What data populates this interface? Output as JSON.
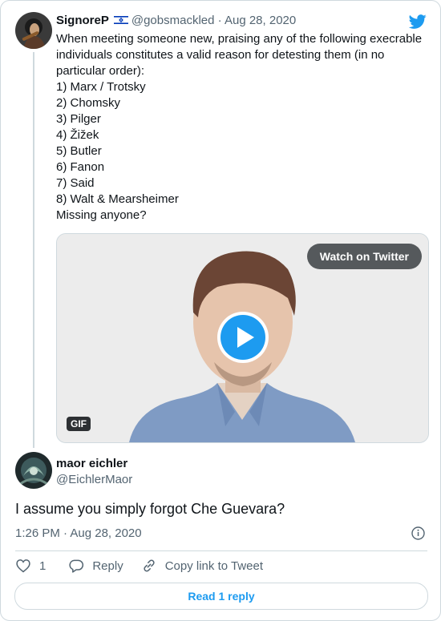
{
  "quoted": {
    "name": "SignoreP",
    "handle": "@gobsmackled",
    "separator": "·",
    "date": "Aug 28, 2020",
    "flag_icon": "israel-flag-icon",
    "text_lines": [
      "When meeting someone new, praising any of the following execrable",
      "individuals constitutes a valid reason for detesting them (in no",
      "particular order):",
      "1) Marx / Trotsky",
      "2) Chomsky",
      "3) Pilger",
      "4) Žižek",
      "5) Butler",
      "6) Fanon",
      "7) Said",
      "8) Walt & Mearsheimer",
      "Missing anyone?"
    ],
    "media": {
      "watch_label": "Watch on Twitter",
      "gif_label": "GIF"
    }
  },
  "main": {
    "name": "maor eichler",
    "handle": "@EichlerMaor",
    "text": "I assume you simply forgot Che Guevara?",
    "timestamp": "1:26 PM · Aug 28, 2020"
  },
  "actions": {
    "like_count": "1",
    "reply_label": "Reply",
    "copy_label": "Copy link to Tweet"
  },
  "read_replies_label": "Read 1 reply",
  "colors": {
    "accent": "#1d9bf0",
    "text": "#0f1419",
    "secondary": "#536471",
    "border": "#cfd9de"
  }
}
